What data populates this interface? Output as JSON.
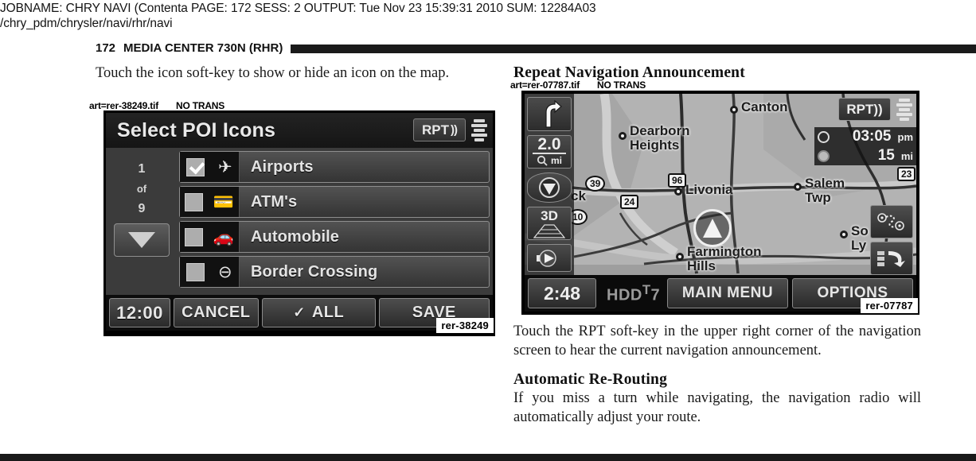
{
  "job_header": {
    "line1_parts": [
      "JOBNAME: CHRY NAVI (Contenta",
      "PAGE: 172",
      "SESS: 2",
      "OUTPUT: Tue Nov 23 15:39:31 2010",
      "SUM: 12284A03"
    ],
    "line1": "JOBNAME: CHRY NAVI (Contenta   PAGE: 172  SESS: 2  OUTPUT: Tue Nov 23 15:39:31 2010  SUM: 12284A03",
    "line2": "/chry_pdm/chrysler/navi/rhr/navi"
  },
  "chapter": {
    "page_number": "172",
    "title": "MEDIA CENTER 730N (RHR)"
  },
  "left_column": {
    "intro_paragraph": "Touch the icon soft-key to show or hide an icon on the map.",
    "art_label": {
      "file": "art=rer-38249.tif",
      "note": "NO TRANS"
    },
    "figure": {
      "badge": "rer-38249",
      "title": "Select POI Icons",
      "rpt_key": {
        "label": "RPT",
        "wave": "))"
      },
      "pager": {
        "current": "1",
        "of": "of",
        "total": "9"
      },
      "rows": [
        {
          "label": "Airports",
          "checked": true,
          "icon": "airplane-icon",
          "glyph": "✈"
        },
        {
          "label": "ATM's",
          "checked": false,
          "icon": "atm-icon",
          "glyph": "Ὃ3"
        },
        {
          "label": "Automobile",
          "checked": false,
          "icon": "automobile-icon",
          "glyph": "Ὡ7"
        },
        {
          "label": "Border Crossing",
          "checked": false,
          "icon": "border-crossing-icon",
          "glyph": "⊖"
        }
      ],
      "footer": {
        "clock": "12:00",
        "cancel": "CANCEL",
        "all": "ALL",
        "all_tick": "✓",
        "save": "SAVE"
      }
    }
  },
  "right_column": {
    "heading1": "Repeat Navigation Announcement",
    "art_label": {
      "file": "art=rer-07787.tif",
      "note": "NO TRANS"
    },
    "figure": {
      "badge": "rer-07787",
      "rpt_key": {
        "label": "RPT",
        "wave": "))"
      },
      "rail": {
        "turn_arrow": "turn-right-arrow",
        "zoom_value": "2.0",
        "zoom_unit": "mi",
        "view_mode": "3D",
        "compass": "compass-down-icon",
        "play": "play-icon"
      },
      "eta": {
        "arrival_time": "03:05",
        "arrival_meridiem": "pm",
        "distance_value": "15",
        "distance_unit": "mi"
      },
      "map_labels": [
        {
          "text": "Canton"
        },
        {
          "text": "Dearborn\nHeights"
        },
        {
          "text": "Livonia"
        },
        {
          "text": "Salem\nTwp"
        },
        {
          "text": "So\nLy"
        },
        {
          "text": "Farmington\nHills"
        },
        {
          "text": "ck"
        }
      ],
      "road_shields": [
        "39",
        "96",
        "24",
        "10",
        "23"
      ],
      "footer": {
        "clock": "2:48",
        "source": "HDD",
        "source_sup": "T",
        "source_num": "7",
        "main_menu": "MAIN MENU",
        "options": "OPTIONS"
      }
    },
    "paragraph1": "Touch the RPT soft-key in the upper right corner of the navigation screen to hear the current navigation announcement.",
    "heading2": "Automatic Re-Routing",
    "paragraph2": "If you miss a turn while navigating, the navigation radio will automatically adjust your route."
  },
  "colors": {
    "rule": "#1a1a1a",
    "text": "#1a1a1a",
    "screen_bg": "#000000",
    "map_bg": "#b0b0b0"
  }
}
